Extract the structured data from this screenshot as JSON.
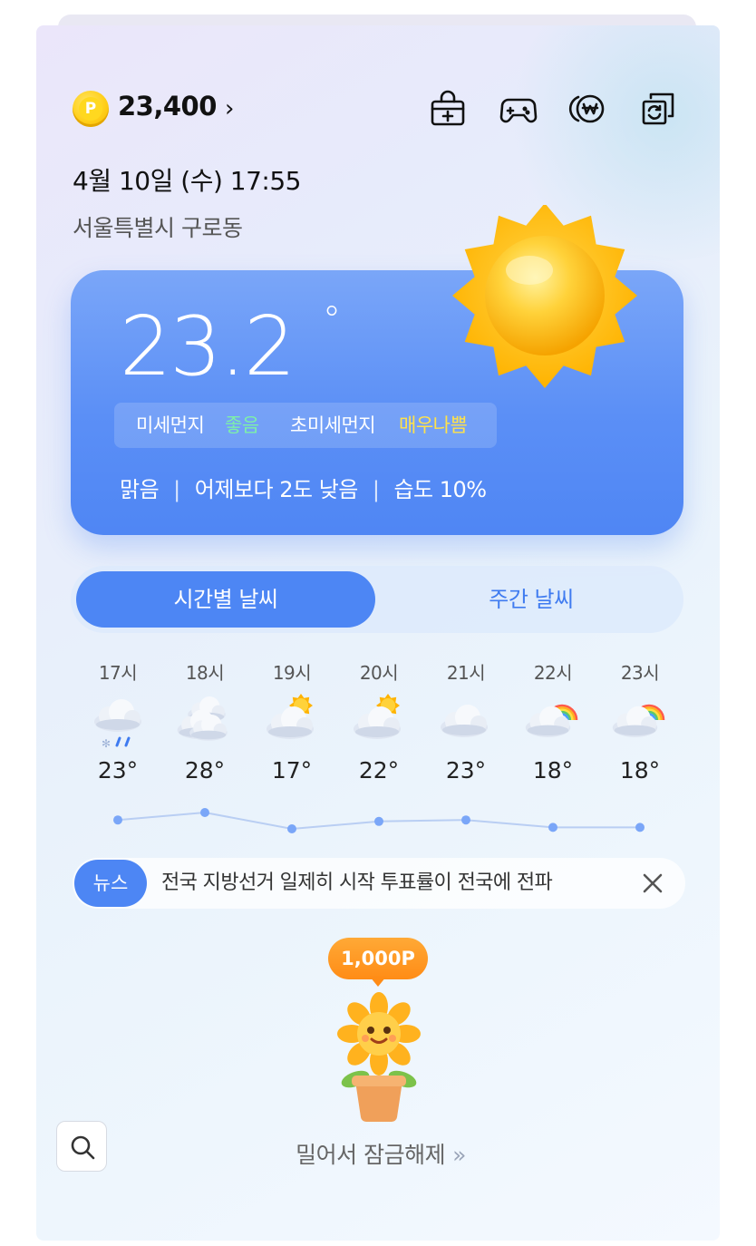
{
  "header": {
    "coin_symbol": "P",
    "points": "23,400",
    "points_chevron": "›",
    "icons": [
      "shop-bag-icon",
      "game-controller-icon",
      "won-coins-icon",
      "exchange-icon"
    ]
  },
  "datetime": "4월 10일 (수) 17:55",
  "location": "서울특별시 구로동",
  "current": {
    "temperature": "23.2",
    "degree_symbol": "°",
    "fine_dust_label": "미세먼지",
    "fine_dust_value": "좋음",
    "ultrafine_dust_label": "초미세먼지",
    "ultrafine_dust_value": "매우나쁨",
    "condition": "맑음",
    "compare": "어제보다 2도 낮음",
    "humidity": "습도 10%",
    "separator": "|",
    "icon": "sun-icon"
  },
  "tabs": {
    "hourly": "시간별 날씨",
    "weekly": "주간 날씨",
    "active": "hourly"
  },
  "hourly": [
    {
      "time": "17시",
      "icon": "snow-rain-cloud-icon",
      "temp": "23°"
    },
    {
      "time": "18시",
      "icon": "cloudy-icon",
      "temp": "28°"
    },
    {
      "time": "19시",
      "icon": "partly-sunny-icon",
      "temp": "17°"
    },
    {
      "time": "20시",
      "icon": "partly-sunny-icon",
      "temp": "22°"
    },
    {
      "time": "21시",
      "icon": "cloud-icon",
      "temp": "23°"
    },
    {
      "time": "22시",
      "icon": "rainbow-cloud-icon",
      "temp": "18°"
    },
    {
      "time": "23시",
      "icon": "rainbow-cloud-icon",
      "temp": "18°"
    }
  ],
  "news": {
    "badge": "뉴스",
    "headline": "전국 지방선거 일제히 시작 투표률이 전국에 전파"
  },
  "reward": {
    "points": "1,000P",
    "unlock_text": "밀어서 잠금해제",
    "unlock_arrow": "»"
  },
  "colors": {
    "accent": "#4d86f4",
    "good": "#7ef0a8",
    "bad": "#ffe24a",
    "reward": "#ff8c16"
  }
}
